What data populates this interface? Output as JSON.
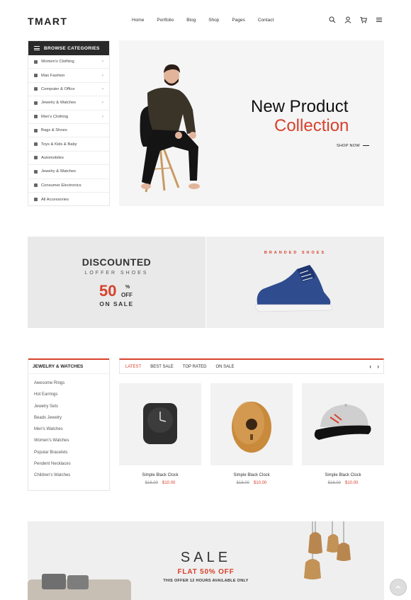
{
  "brand": {
    "logo": "TMART",
    "accent": "#d8412b"
  },
  "nav": {
    "items": [
      "Home",
      "Portfolio",
      "Blog",
      "Shop",
      "Pages",
      "Contact"
    ]
  },
  "header_icons": [
    "search-icon",
    "user-icon",
    "cart-icon",
    "menu-icon"
  ],
  "categories": {
    "title": "BROWSE CATEGORIES",
    "items": [
      {
        "label": "Women's Clothing",
        "has_sub": true
      },
      {
        "label": "Man Fashion",
        "has_sub": true
      },
      {
        "label": "Computer & Office",
        "has_sub": true
      },
      {
        "label": "Jewelry & Watches",
        "has_sub": true
      },
      {
        "label": "Men's Clothing",
        "has_sub": true
      },
      {
        "label": "Bags & Shoes",
        "has_sub": false
      },
      {
        "label": "Toys & Kids & Baby",
        "has_sub": false
      },
      {
        "label": "Automobiles",
        "has_sub": false
      },
      {
        "label": "Jewelry & Watches",
        "has_sub": false
      },
      {
        "label": "Consumer Electronics",
        "has_sub": false
      },
      {
        "label": "All Accessories",
        "has_sub": false
      }
    ]
  },
  "hero": {
    "title_line1": "New Product",
    "title_line2": "Collection",
    "cta": "SHOP NOW"
  },
  "banner": {
    "left": {
      "line1": "DISCOUNTED",
      "line2": "LOFFER SHOES",
      "percent": "50",
      "percent_symbol": "%",
      "off": "OFF",
      "tagline": "ON SALE"
    },
    "right": {
      "label": "BRANDED SHOES"
    }
  },
  "jewelry": {
    "title": "JEWELRY & WATCHES",
    "items": [
      "Awesome Rings",
      "Hot Earrings",
      "Jewelry Sets",
      "Beads Jewelry",
      "Men's Watches",
      "Women's Watches",
      "Popular Bracelets",
      "Pendent Necklaces",
      "Children's Watches"
    ]
  },
  "product_tabs": {
    "tabs": [
      "LATEST",
      "BEST SALE",
      "TOP RATED",
      "ON SALE"
    ],
    "active": 0,
    "prev": "‹",
    "next": "›"
  },
  "products": [
    {
      "name": "Simple Black Clock",
      "old_price": "$16.00",
      "price": "$10.00",
      "image": "black-clock"
    },
    {
      "name": "Simple Black Clock",
      "old_price": "$16.00",
      "price": "$10.00",
      "image": "wooden-birdhouse"
    },
    {
      "name": "Simple Black Clock",
      "old_price": "$16.00",
      "price": "$10.00",
      "image": "snapback-cap"
    }
  ],
  "sale": {
    "title": "SALE",
    "subtitle": "FLAT 50% OFF",
    "note": "THIS OFFER 12 HOURS AVAILABLE ONLY"
  }
}
